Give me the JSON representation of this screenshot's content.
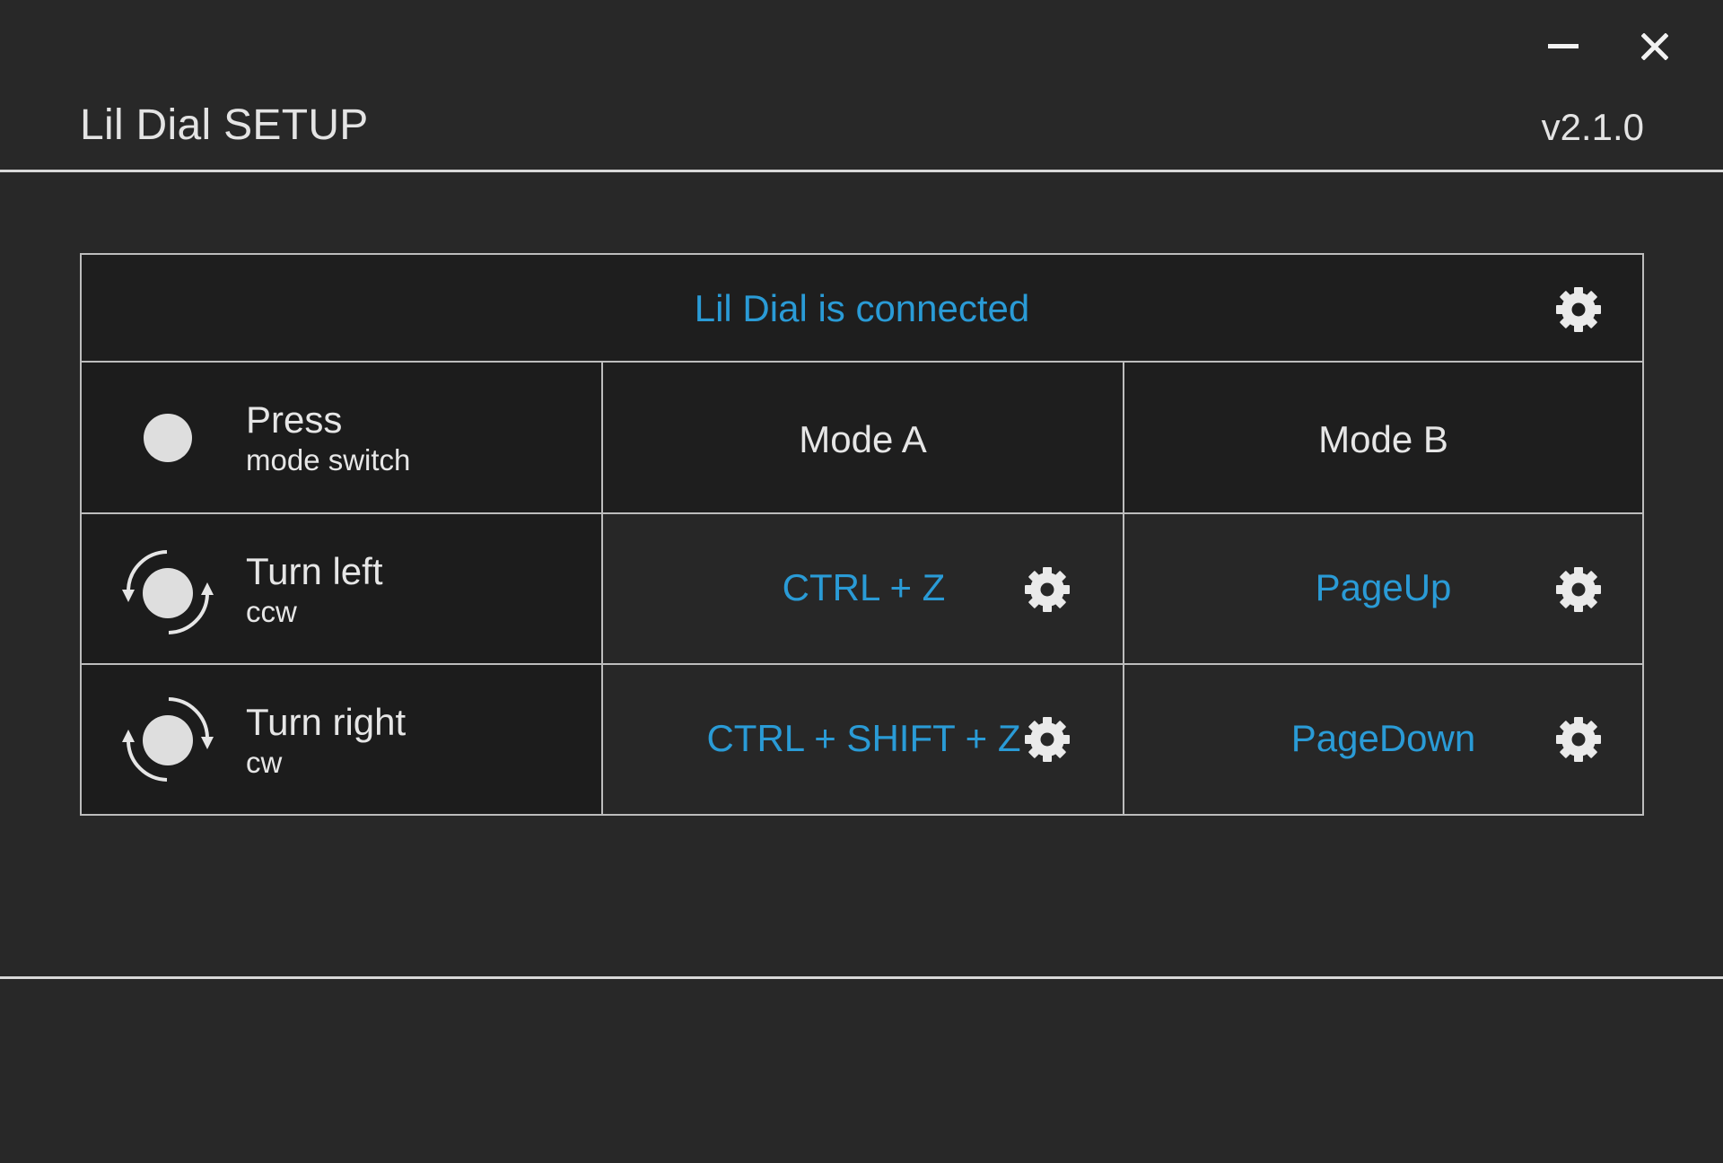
{
  "window": {
    "title": "Lil Dial SETUP",
    "version": "v2.1.0",
    "minimize_icon": "minimize-icon",
    "close_icon": "close-icon"
  },
  "status": {
    "text": "Lil Dial is connected",
    "settings_icon": "gear-icon"
  },
  "table": {
    "header": {
      "action_label": "Press",
      "action_sub": "mode switch",
      "mode_a": "Mode A",
      "mode_b": "Mode B"
    },
    "rows": [
      {
        "label": "Turn left",
        "sub": "ccw",
        "icon": "rotate-left-icon",
        "mode_a": "CTRL + Z",
        "mode_b": "PageUp"
      },
      {
        "label": "Turn right",
        "sub": "cw",
        "icon": "rotate-right-icon",
        "mode_a": "CTRL + SHIFT + Z",
        "mode_b": "PageDown"
      }
    ]
  },
  "colors": {
    "background": "#282828",
    "accent": "#2a9bd6",
    "text": "#e6e6e6",
    "border": "#bdbdbd"
  }
}
